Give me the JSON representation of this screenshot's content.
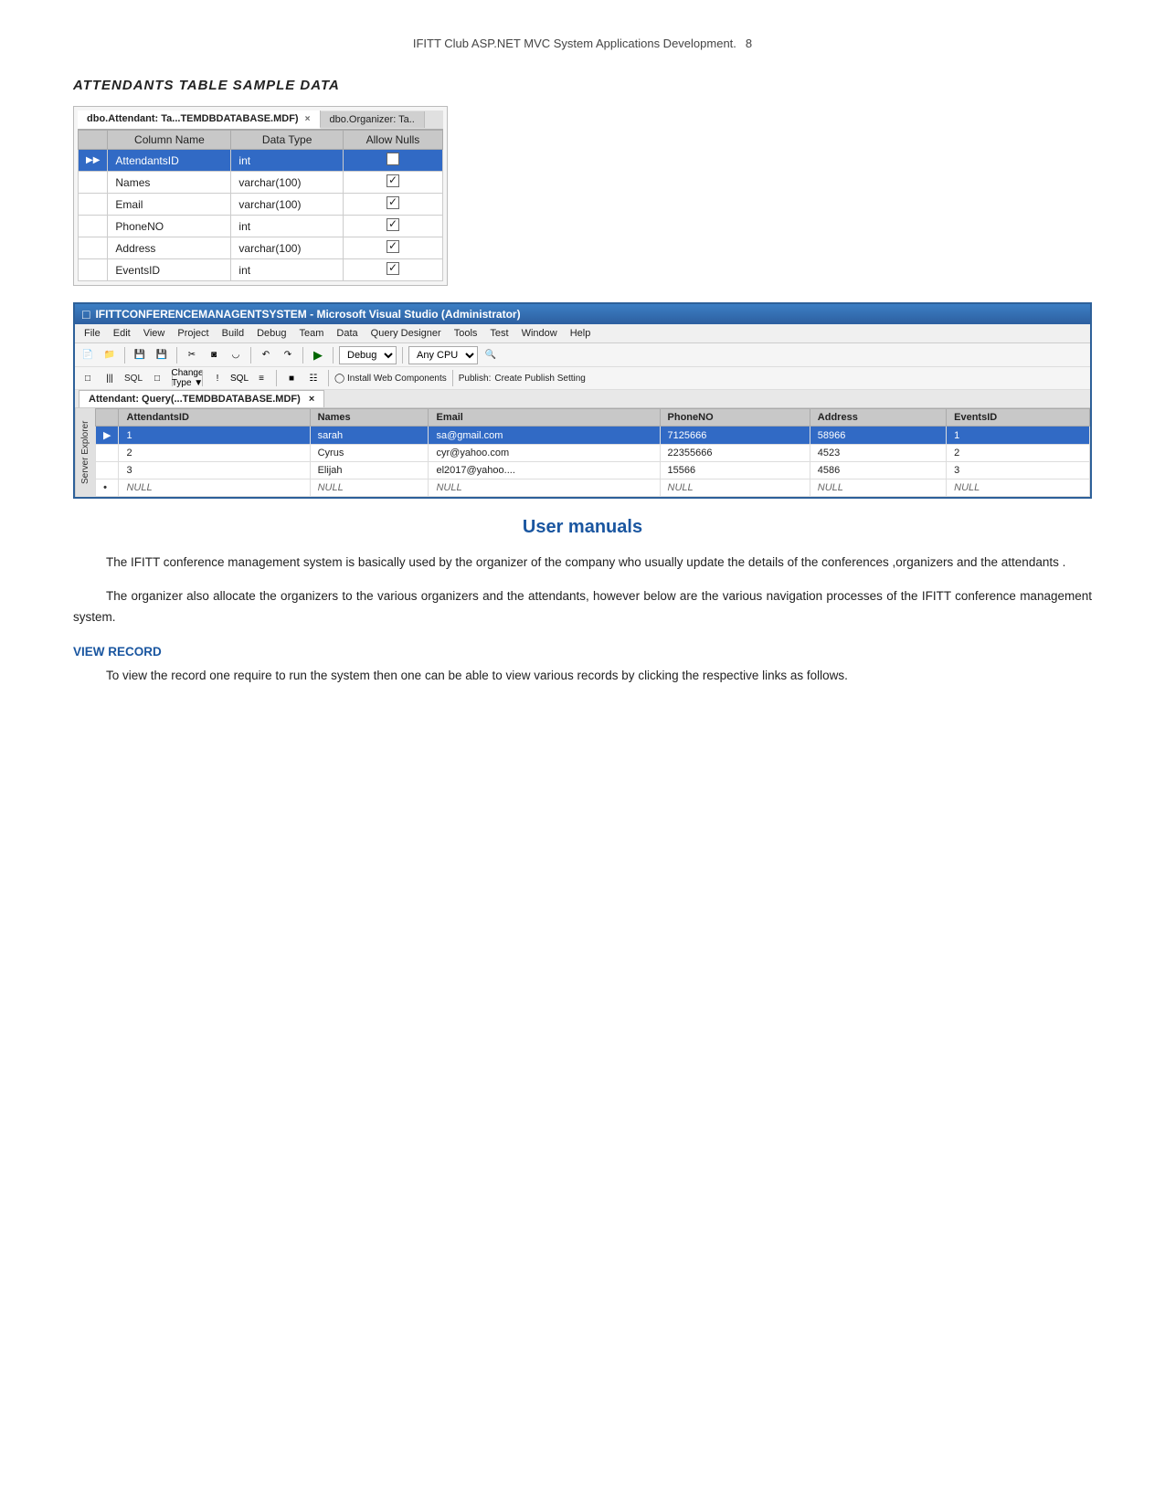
{
  "header": {
    "title": "IFITT  Club ASP.NET MVC System Applications Development.",
    "page_number": "8"
  },
  "section_title": "ATTENDANTS  TABLE SAMPLE DATA",
  "schema_tab": {
    "tab1_label": "dbo.Attendant: Ta...TEMDBDATABASE.MDF)",
    "tab2_label": "dbo.Organizer: Ta..",
    "tab_close": "×"
  },
  "schema_table": {
    "col_name_header": "Column Name",
    "data_type_header": "Data Type",
    "allow_nulls_header": "Allow Nulls",
    "rows": [
      {
        "indicator": "▶▶",
        "name": "AttendantsID",
        "type": "int",
        "allow_null": false
      },
      {
        "indicator": "",
        "name": "Names",
        "type": "varchar(100)",
        "allow_null": true
      },
      {
        "indicator": "",
        "name": "Email",
        "type": "varchar(100)",
        "allow_null": true
      },
      {
        "indicator": "",
        "name": "PhoneNO",
        "type": "int",
        "allow_null": true
      },
      {
        "indicator": "",
        "name": "Address",
        "type": "varchar(100)",
        "allow_null": true
      },
      {
        "indicator": "",
        "name": "EventsID",
        "type": "int",
        "allow_null": true
      }
    ]
  },
  "vs_window": {
    "title": "IFITTCONFERENCEMANAGENTSYSTEM - Microsoft Visual Studio (Administrator)",
    "menu_items": [
      "File",
      "Edit",
      "View",
      "Project",
      "Build",
      "Debug",
      "Team",
      "Data",
      "Query Designer",
      "Tools",
      "Test",
      "Window",
      "Help"
    ],
    "toolbar1": {
      "debug_label": "Debug",
      "cpu_label": "Any CPU"
    },
    "toolbar2": {
      "change_type_label": "Change Type ▼",
      "install_web_label": "Install Web Components",
      "publish_label": "Publish:",
      "create_publish_label": "Create Publish Setting"
    },
    "doc_tab_label": "Attendant: Query(...TEMDBDATABASE.MDF)",
    "doc_tab_close": "×"
  },
  "sidebar_label": "Server Explorer",
  "result_table": {
    "columns": [
      "AttendantsID",
      "Names",
      "Email",
      "PhoneNO",
      "Address",
      "EventsID"
    ],
    "rows": [
      {
        "indicator": "▶",
        "id": "1",
        "name": "sarah",
        "email": "sa@gmail.com",
        "phone": "7125666",
        "address": "58966",
        "eventsid": "1",
        "selected": true
      },
      {
        "indicator": "",
        "id": "2",
        "name": "Cyrus",
        "email": "cyr@yahoo.com",
        "phone": "22355666",
        "address": "4523",
        "eventsid": "2",
        "selected": false
      },
      {
        "indicator": "",
        "id": "3",
        "name": "Elijah",
        "email": "el2017@yahoo....",
        "phone": "15566",
        "address": "4586",
        "eventsid": "3",
        "selected": false
      },
      {
        "indicator": "•",
        "id": "NULL",
        "name": "NULL",
        "email": "NULL",
        "phone": "NULL",
        "address": "NULL",
        "eventsid": "NULL",
        "null_row": true
      }
    ]
  },
  "user_manuals_heading": "User manuals",
  "body_paragraph1": "The IFITT conference management system is basically used by the organizer of the company who usually update the details of the conferences ,organizers and the attendants .",
  "body_paragraph2": "The organizer also allocate the organizers to the various organizers and the attendants, however below are the various navigation processes of the IFITT conference management system.",
  "view_record_heading": "VIEW RECORD",
  "view_record_text": "To view the record one require to run the system then one can be able to view various records by clicking the respective links as follows."
}
